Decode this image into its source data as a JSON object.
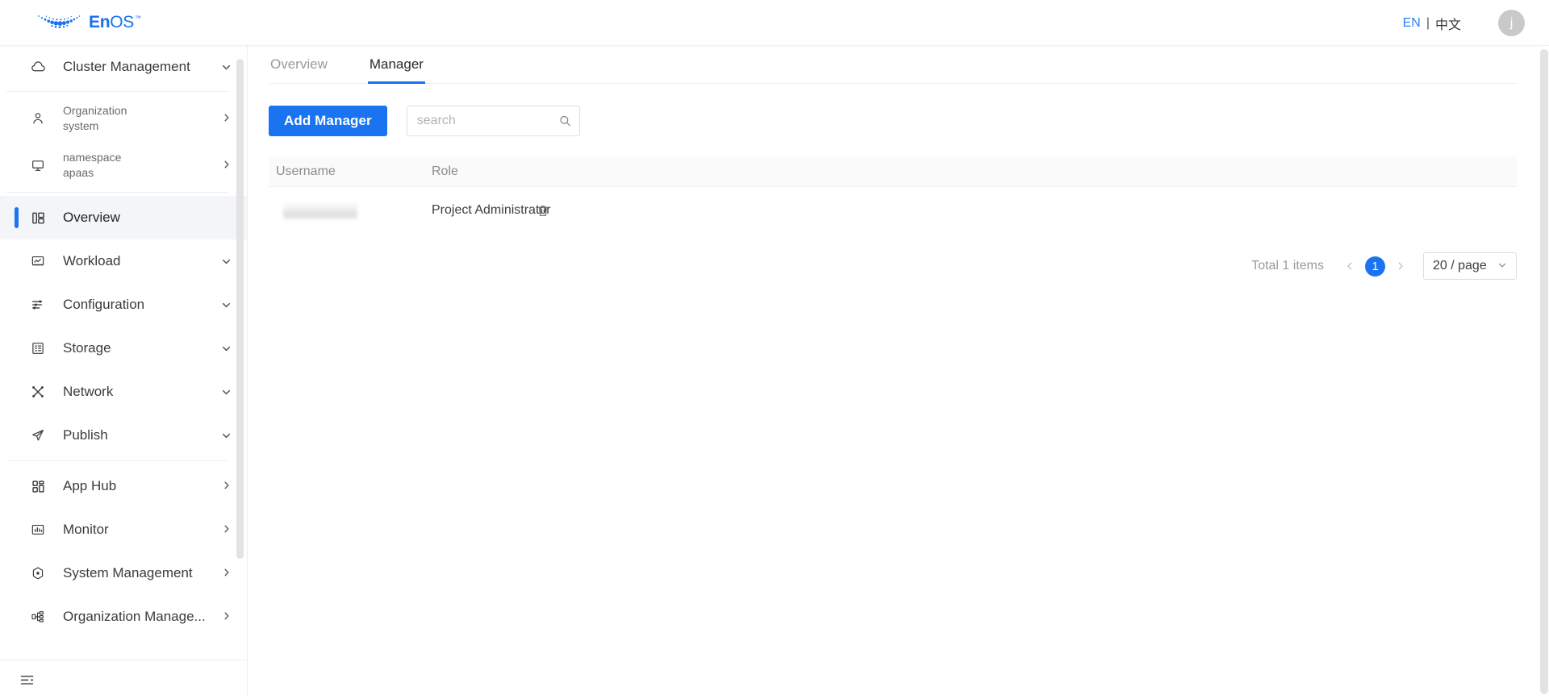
{
  "header": {
    "brand": {
      "en": "En",
      "os": "OS",
      "tm": "™",
      "logo_icon": "enos-swoosh-logo"
    },
    "language": {
      "en_label": "EN",
      "separator": "|",
      "cn_label": "中文"
    },
    "avatar_initial": "j"
  },
  "sidebar": {
    "cluster": {
      "label": "Cluster Management",
      "icon": "cloud-icon",
      "caret": "chevron-down-icon"
    },
    "context_items": [
      {
        "top": "Organization",
        "sub": "system",
        "icon": "user-icon",
        "arrow": "chevron-right-icon"
      },
      {
        "top": "namespace",
        "sub": "apaas",
        "icon": "monitor-icon",
        "arrow": "chevron-right-icon"
      }
    ],
    "items": [
      {
        "label": "Overview",
        "icon": "dashboard-icon",
        "active": true,
        "arrow": ""
      },
      {
        "label": "Workload",
        "icon": "workload-icon",
        "active": false,
        "arrow": "chevron-down-icon"
      },
      {
        "label": "Configuration",
        "icon": "sliders-icon",
        "active": false,
        "arrow": "chevron-down-icon"
      },
      {
        "label": "Storage",
        "icon": "storage-icon",
        "active": false,
        "arrow": "chevron-down-icon"
      },
      {
        "label": "Network",
        "icon": "network-icon",
        "active": false,
        "arrow": "chevron-down-icon"
      },
      {
        "label": "Publish",
        "icon": "send-icon",
        "active": false,
        "arrow": "chevron-down-icon"
      }
    ],
    "items2": [
      {
        "label": "App Hub",
        "icon": "grid-icon",
        "active": false,
        "arrow": "chevron-right-icon"
      },
      {
        "label": "Monitor",
        "icon": "monitor-chart-icon",
        "active": false,
        "arrow": "chevron-right-icon"
      },
      {
        "label": "System Management",
        "icon": "gear-hex-icon",
        "active": false,
        "arrow": "chevron-right-icon"
      },
      {
        "label": "Organization Manage...",
        "icon": "org-tree-icon",
        "active": false,
        "arrow": "chevron-right-icon"
      }
    ],
    "footer": {
      "collapse_icon": "collapse-sidebar-icon"
    }
  },
  "main": {
    "tabs": [
      {
        "label": "Overview",
        "active": false
      },
      {
        "label": "Manager",
        "active": true
      }
    ],
    "toolbar": {
      "add_label": "Add Manager",
      "search_placeholder": "search",
      "search_value": "",
      "search_icon": "search-icon"
    },
    "table": {
      "columns": [
        "Username",
        "Role"
      ],
      "rows": [
        {
          "username": "",
          "username_redacted": true,
          "role": "Project Administrator",
          "delete_icon": "trash-icon"
        }
      ]
    },
    "pagination": {
      "total_text": "Total 1 items",
      "prev_icon": "chevron-left-icon",
      "next_icon": "chevron-right-icon",
      "current_page": "1",
      "page_size": "20 / page",
      "page_size_caret": "chevron-down-icon"
    }
  },
  "colors": {
    "accent": "#1a73f0",
    "link": "#2d7ff9",
    "active_nav_bg": "#f4f5f9",
    "table_head_bg": "#fafafb",
    "border": "#efefef"
  }
}
